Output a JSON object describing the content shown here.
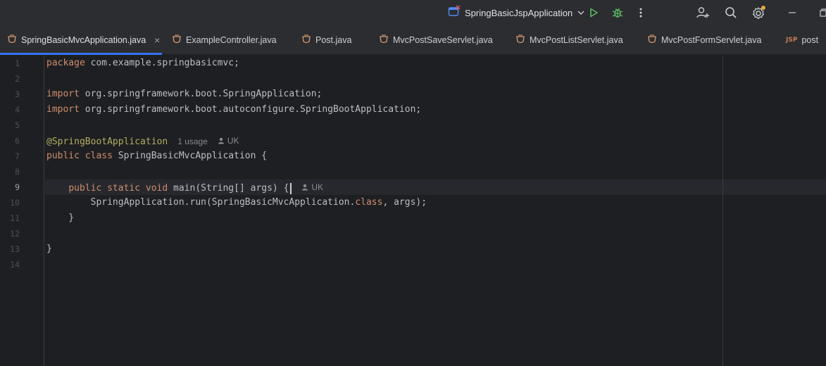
{
  "titlebar": {
    "run_config": "SpringBasicJspApplication",
    "icons": [
      "run-config-icon",
      "chevron-down-icon",
      "run-icon",
      "debug-icon",
      "more-icon",
      "add-user-icon",
      "search-icon",
      "settings-icon",
      "minimize-icon",
      "restore-icon"
    ]
  },
  "tabs": [
    {
      "label": "SpringBasicMvcApplication.java",
      "icon": "java-class-icon",
      "active": true,
      "close": "×"
    },
    {
      "label": "ExampleController.java",
      "icon": "java-class-icon"
    },
    {
      "label": "Post.java",
      "icon": "java-class-icon"
    },
    {
      "label": "MvcPostSaveServlet.java",
      "icon": "java-class-icon"
    },
    {
      "label": "MvcPostListServlet.java",
      "icon": "java-class-icon"
    },
    {
      "label": "MvcPostFormServlet.java",
      "icon": "java-class-icon"
    },
    {
      "label": "post",
      "icon": "jsp-file-icon",
      "badge": "JSP"
    }
  ],
  "editor": {
    "line_numbers": [
      "1",
      "2",
      "3",
      "4",
      "5",
      "6",
      "7",
      "8",
      "9",
      "10",
      "11",
      "12",
      "13",
      "14"
    ],
    "current_line": "9",
    "lines": {
      "l1": {
        "kw": "package",
        "rest": " com.example.springbasicmvc;"
      },
      "l3": {
        "kw": "import",
        "rest": " org.springframework.boot.SpringApplication;"
      },
      "l4": {
        "kw": "import",
        "rest": " org.springframework.boot.autoconfigure.SpringBootApplication;"
      },
      "l6": {
        "annotation": "@SpringBootApplication",
        "usage": "1 usage",
        "author": "UK"
      },
      "l7": {
        "kw1": "public",
        "kw2": "class",
        "rest": " SpringBasicMvcApplication {"
      },
      "l9": {
        "indent": "    ",
        "kw1": "public",
        "kw2": "static",
        "kw3": "void",
        "rest": " main(String[] args) {",
        "author": "UK"
      },
      "l10": {
        "indent": "        ",
        "pre": "SpringApplication.run(SpringBasicMvcApplication.",
        "kw": "class",
        "post": ", args);"
      },
      "l11": {
        "text": "    }"
      },
      "l13": {
        "text": "}"
      }
    }
  },
  "colors": {
    "accent": "#3574f0",
    "keyword": "#cf8e6d",
    "annotation": "#b3ae60",
    "background": "#1e1f22"
  }
}
